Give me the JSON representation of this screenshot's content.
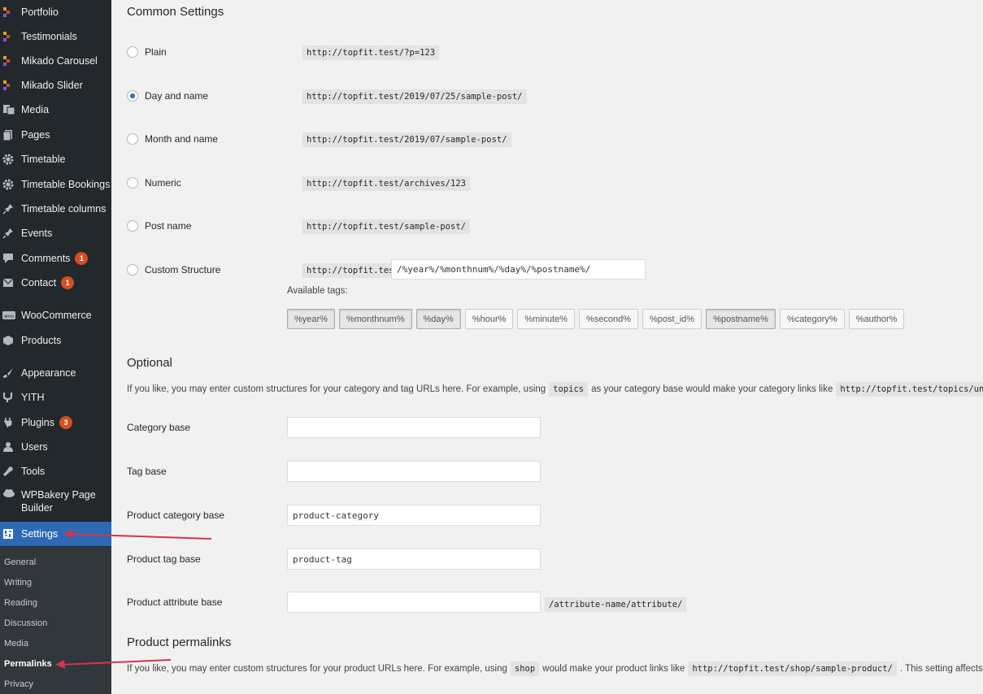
{
  "sidebar": {
    "items": [
      {
        "label": "Portfolio",
        "icon": "mikado-icon"
      },
      {
        "label": "Testimonials",
        "icon": "mikado-icon"
      },
      {
        "label": "Mikado Carousel",
        "icon": "mikado-icon"
      },
      {
        "label": "Mikado Slider",
        "icon": "mikado-icon"
      },
      {
        "label": "Media",
        "icon": "media-icon"
      },
      {
        "label": "Pages",
        "icon": "pages-icon"
      },
      {
        "label": "Timetable",
        "icon": "gear-icon"
      },
      {
        "label": "Timetable Bookings",
        "icon": "gear-icon"
      },
      {
        "label": "Timetable columns",
        "icon": "pin-icon"
      },
      {
        "label": "Events",
        "icon": "pin-icon"
      },
      {
        "label": "Comments",
        "icon": "comment-icon",
        "badge": "1"
      },
      {
        "label": "Contact",
        "icon": "mail-icon",
        "badge": "1"
      },
      {
        "label": "WooCommerce",
        "icon": "woo-icon"
      },
      {
        "label": "Products",
        "icon": "products-icon"
      },
      {
        "label": "Appearance",
        "icon": "brush-icon"
      },
      {
        "label": "YITH",
        "icon": "yith-icon"
      },
      {
        "label": "Plugins",
        "icon": "plugin-icon",
        "badge": "3"
      },
      {
        "label": "Users",
        "icon": "users-icon"
      },
      {
        "label": "Tools",
        "icon": "wrench-icon"
      },
      {
        "label": "WPBakery Page Builder",
        "icon": "cloud-icon"
      },
      {
        "label": "Settings",
        "icon": "settings-icon",
        "active": true
      }
    ],
    "submenu": [
      "General",
      "Writing",
      "Reading",
      "Discussion",
      "Media",
      "Permalinks",
      "Privacy"
    ],
    "current_submenu": "Permalinks"
  },
  "common": {
    "heading": "Common Settings",
    "options": [
      {
        "label": "Plain",
        "url": "http://topfit.test/?p=123",
        "checked": false
      },
      {
        "label": "Day and name",
        "url": "http://topfit.test/2019/07/25/sample-post/",
        "checked": true
      },
      {
        "label": "Month and name",
        "url": "http://topfit.test/2019/07/sample-post/",
        "checked": false
      },
      {
        "label": "Numeric",
        "url": "http://topfit.test/archives/123",
        "checked": false
      },
      {
        "label": "Post name",
        "url": "http://topfit.test/sample-post/",
        "checked": false
      }
    ],
    "custom": {
      "label": "Custom Structure",
      "prefix": "http://topfit.test",
      "value": "/%year%/%monthnum%/%day%/%postname%/"
    },
    "available_tags_label": "Available tags:",
    "tags": [
      {
        "label": "%year%",
        "pressed": true
      },
      {
        "label": "%monthnum%",
        "pressed": true
      },
      {
        "label": "%day%",
        "pressed": true
      },
      {
        "label": "%hour%",
        "pressed": false
      },
      {
        "label": "%minute%",
        "pressed": false
      },
      {
        "label": "%second%",
        "pressed": false
      },
      {
        "label": "%post_id%",
        "pressed": false
      },
      {
        "label": "%postname%",
        "pressed": true
      },
      {
        "label": "%category%",
        "pressed": false
      },
      {
        "label": "%author%",
        "pressed": false
      }
    ]
  },
  "optional": {
    "heading": "Optional",
    "intro_before": "If you like, you may enter custom structures for your category and tag URLs here. For example, using",
    "intro_code": "topics",
    "intro_after": "as your category base would make your category links like",
    "intro_url": "http://topfit.test/topics/un",
    "fields": [
      {
        "label": "Category base",
        "value": ""
      },
      {
        "label": "Tag base",
        "value": ""
      },
      {
        "label": "Product category base",
        "value": "product-category"
      },
      {
        "label": "Product tag base",
        "value": "product-tag"
      },
      {
        "label": "Product attribute base",
        "value": "",
        "suffix": "/attribute-name/attribute/"
      }
    ]
  },
  "product_permalinks": {
    "heading": "Product permalinks",
    "intro_before": "If you like, you may enter custom structures for your product URLs here. For example, using",
    "intro_code": "shop",
    "intro_after": "would make your product links like",
    "intro_url": "http://topfit.test/shop/sample-product/",
    "intro_end": ". This setting affects"
  },
  "colors": {
    "sidebar_bg": "#23282d",
    "active_bg": "#2e6ab3",
    "badge": "#d54e21",
    "annotation_arrow": "#d6334f"
  }
}
